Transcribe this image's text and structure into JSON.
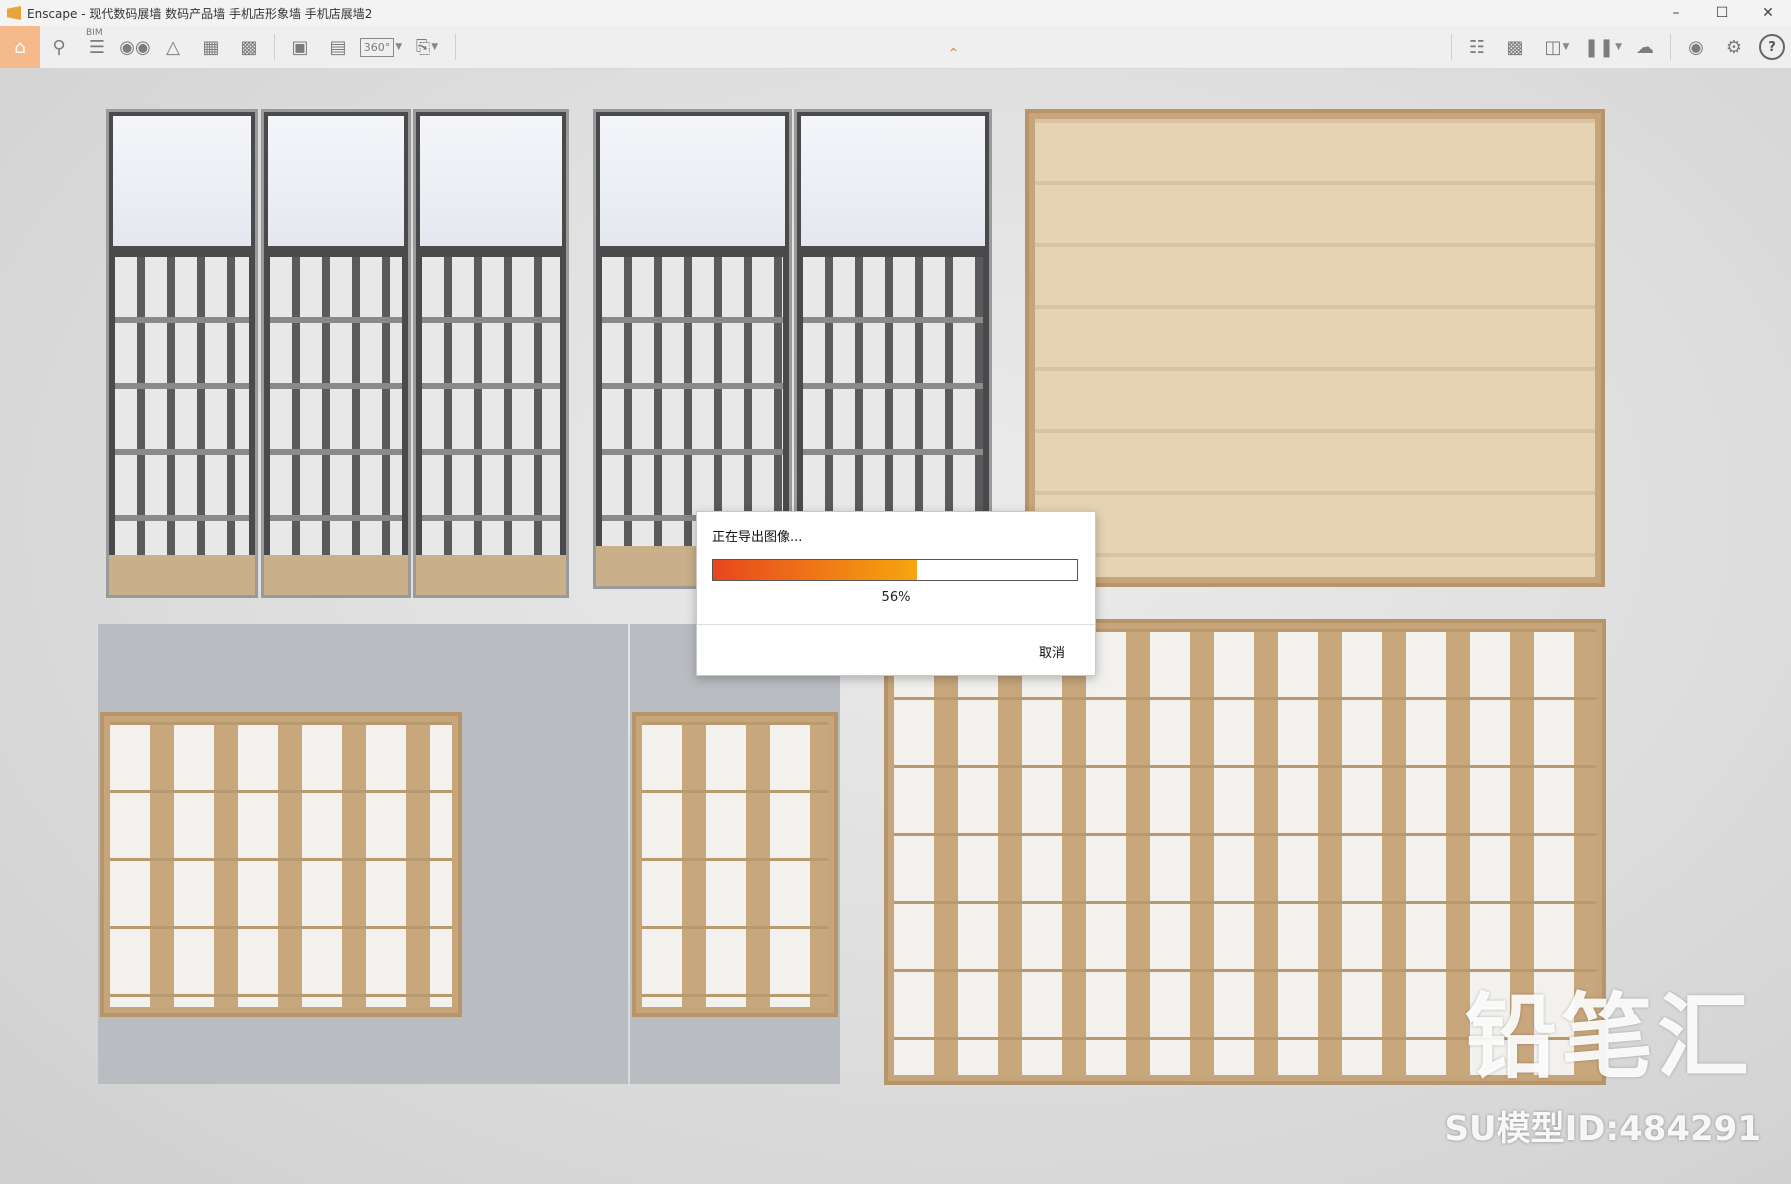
{
  "window": {
    "title": "Enscape - 现代数码展墙 数码产品墙 手机店形象墙 手机店展墙2",
    "controls": [
      "minimize",
      "maximize",
      "close"
    ]
  },
  "toolbar": {
    "bim_label": "BIM",
    "left_icons": [
      "home-icon",
      "location-pin-icon",
      "list-icon",
      "binoculars-icon",
      "asset-library-icon",
      "buildings-icon",
      "clapboard-icon",
      "screenshot-icon",
      "batch-render-icon",
      "panorama-360-icon",
      "export-exe-icon"
    ],
    "panorama_label": "360°",
    "right_icons": [
      "map-icon",
      "views-icon",
      "cube-icon",
      "library-icon",
      "cloud-upload-icon",
      "visibility-icon",
      "settings-icon",
      "help-icon"
    ],
    "help_label": "?"
  },
  "dialog": {
    "title": "正在导出图像...",
    "progress": 0.56,
    "percent_label": "56%",
    "cancel_label": "取消",
    "bar_colors": {
      "start": "#e8461e",
      "end": "#f6a60f"
    }
  },
  "watermark": {
    "brand": "铅笔汇",
    "model_id": "SU模型ID:484291"
  }
}
